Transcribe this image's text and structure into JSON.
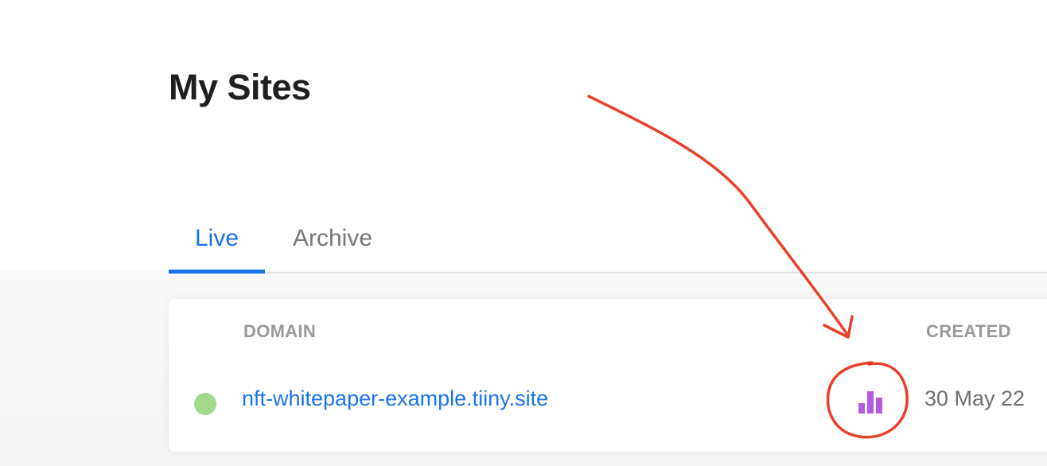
{
  "page": {
    "title": "My Sites"
  },
  "tabs": [
    {
      "label": "Live",
      "active": true
    },
    {
      "label": "Archive",
      "active": false
    }
  ],
  "table": {
    "columns": {
      "domain": "DOMAIN",
      "created": "CREATED"
    },
    "rows": [
      {
        "status": "live",
        "domain": "nft-whitepaper-example.tiiny.site",
        "analytics_icon": "bar-chart-icon",
        "created": "30 May 22"
      }
    ]
  },
  "annotation": {
    "shape": "hand-drawn arrow pointing to circled analytics icon",
    "color": "#e8402a"
  },
  "colors": {
    "accent": "#1a73e8",
    "status_live": "#a3d98a",
    "analytics_icon": "#b45be0",
    "annotation": "#e8402a"
  }
}
